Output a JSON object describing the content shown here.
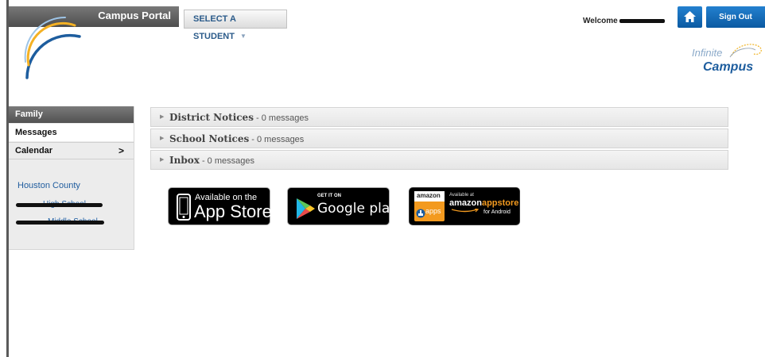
{
  "header": {
    "portal_title": "Campus Portal",
    "student_select": {
      "value": "SELECT A STUDENT",
      "options": [
        "SELECT A STUDENT"
      ]
    },
    "welcome_label": "Welcome",
    "home_icon": "home-icon",
    "sign_out_label": "Sign Out",
    "brand": {
      "word1": "Infinite",
      "word2": "Campus"
    }
  },
  "sidebar": {
    "family_label": "Family",
    "items": [
      {
        "label": "Messages",
        "selected": true
      },
      {
        "label": "Calendar",
        "icon": "chevron-right-icon"
      }
    ],
    "district_name": "Houston County",
    "schools": [
      "High School",
      "Middle School"
    ]
  },
  "notices": [
    {
      "title": "District Notices",
      "count_text": " - 0 messages"
    },
    {
      "title": "School Notices",
      "count_text": " - 0 messages"
    },
    {
      "title": "Inbox",
      "count_text": " - 0 messages"
    }
  ],
  "badges": {
    "appstore": {
      "line1": "Available on the",
      "line2": "App Store"
    },
    "googleplay": {
      "line1": "GET IT ON",
      "line2": "Google play"
    },
    "amazon": {
      "logo": "amazon",
      "apps": "apps",
      "line1": "Available at",
      "line2a": "amazon",
      "line2b": "appstore",
      "line3": "for Android"
    }
  },
  "colors": {
    "accent_blue": "#0b5aa2",
    "link_blue": "#1f5c9e",
    "nav_dark": "#525252",
    "amazon_orange": "#f39a1f"
  }
}
